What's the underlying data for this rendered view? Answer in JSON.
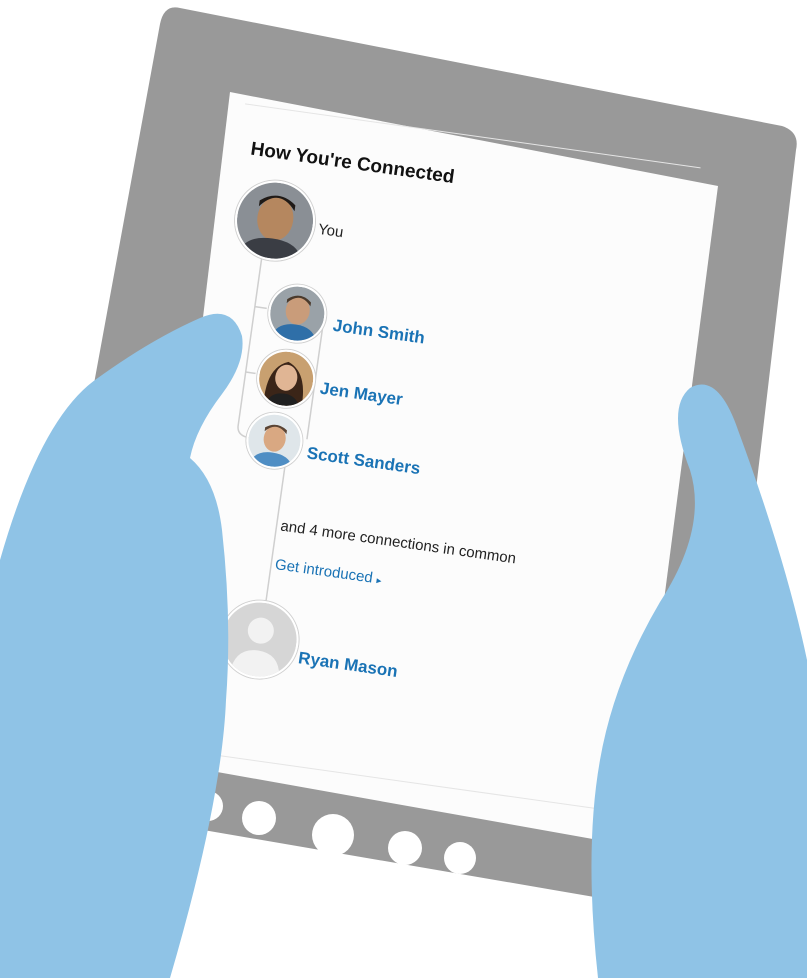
{
  "panel": {
    "title": "How You're Connected",
    "you_label": "You",
    "connections": [
      {
        "name": "John Smith"
      },
      {
        "name": "Jen Mayer"
      },
      {
        "name": "Scott Sanders"
      }
    ],
    "more_text": "and 4 more connections in common",
    "cta_label": "Get introduced",
    "cta_icon": "caret-right-icon",
    "target_name": "Ryan Mason"
  },
  "colors": {
    "tablet_frame": "#999999",
    "hands": "#8fc3e6",
    "link": "#1a73b5",
    "screen_bg": "#fcfcfc"
  }
}
